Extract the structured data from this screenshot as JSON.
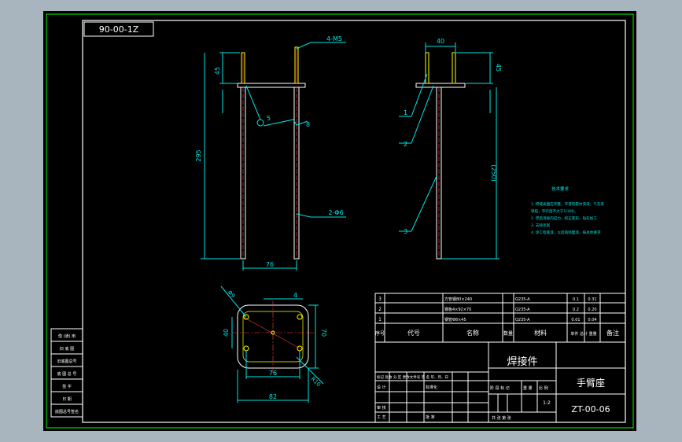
{
  "drawing": {
    "number_box": "90-00-1Z",
    "part_name": "焊接件",
    "assembly_name": "手臂座",
    "drawing_number": "ZT-00-06",
    "scale": "1:2"
  },
  "front_view": {
    "dim_45": "45",
    "dim_295": "295",
    "dim_76": "76",
    "note_4m5": "4-M5",
    "note_2d6": "2-Φ6",
    "balloon_5": "5",
    "label_8": "8"
  },
  "side_view": {
    "dim_40": "40",
    "dim_45": "45",
    "dim_250": "(250)",
    "balloon_1": "1",
    "balloon_2": "2",
    "balloon_3": "3"
  },
  "plan_view": {
    "dim_d9": "Φ9",
    "dim_4": "4",
    "dim_40": "40",
    "dim_70": "70",
    "dim_76": "76",
    "dim_82": "82",
    "dim_r10": "R10"
  },
  "tech_notes": {
    "title": "技术要求",
    "lines": [
      "1. 焊缝表面应平整，不得有裂纹夹渣，气孔等",
      "缺陷，平行度不大于1/300。",
      "2. 焊后消除内应力，校正变形，钻孔加工",
      "3. 去除毛刺",
      "4. 涂工程底漆，以后再喷面漆，按总体要求"
    ]
  },
  "bom": {
    "rows": [
      {
        "no": "3",
        "spec": "方管钢80×240",
        "material": "Q235-A",
        "qty": "0.1",
        "weight": "0.31"
      },
      {
        "no": "2",
        "spec": "钢板4×92×70",
        "material": "Q235-A",
        "qty": "0.2",
        "weight": "0.20"
      },
      {
        "no": "1",
        "spec": "钢管Φ8×45",
        "material": "Q235-A",
        "qty": "0.01",
        "weight": "0.04"
      }
    ],
    "header": {
      "no": "序号",
      "code": "代号",
      "name": "名称",
      "qty": "数量",
      "material": "材料",
      "weight": "单件 总计 重量",
      "remark": "备注"
    }
  },
  "title_block": {
    "row_mark": "标记  处数  分 区  更改文件号  签 名  年、月、日",
    "design": "设 计",
    "standardize": "标准化",
    "stage": "阶 段 标 记",
    "weight": "重 量",
    "scale_label": "比 例",
    "review": "审 核",
    "process": "工 艺",
    "approve": "批 准",
    "sheets": "共    张    第    张"
  },
  "left_strip": {
    "labels": [
      "借 (通) 用",
      "旧 底 图",
      "旧底图总号",
      "底 图 总 号",
      "签    字",
      "日    期",
      "底图总号签名"
    ]
  }
}
